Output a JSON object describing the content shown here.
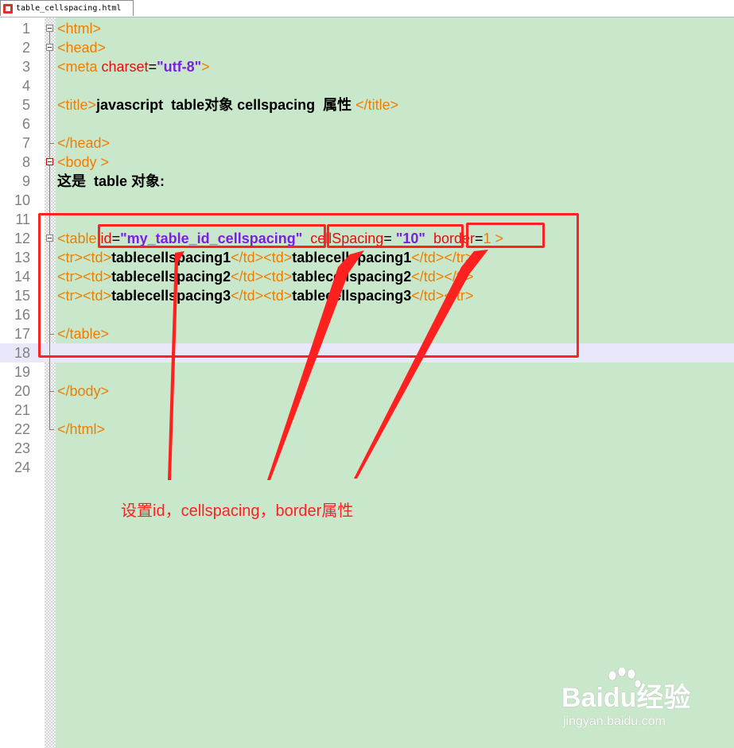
{
  "tab": {
    "label": "table_cellspacing.html"
  },
  "lines": [
    {
      "n": "1",
      "tokens": [
        [
          "t",
          "<html>"
        ]
      ]
    },
    {
      "n": "2",
      "tokens": [
        [
          "t",
          "<head>"
        ]
      ]
    },
    {
      "n": "3",
      "tokens": [
        [
          "t",
          "<meta "
        ],
        [
          "a",
          "charset"
        ],
        [
          "e",
          "="
        ],
        [
          "v",
          "\"utf-8\""
        ],
        [
          "t",
          ">"
        ]
      ]
    },
    {
      "n": "4",
      "tokens": []
    },
    {
      "n": "5",
      "tokens": [
        [
          "t",
          "<title>"
        ],
        [
          "x",
          "javascript  table对象 cellspacing  属性 "
        ],
        [
          "t",
          "</title>"
        ]
      ]
    },
    {
      "n": "6",
      "tokens": []
    },
    {
      "n": "7",
      "tokens": [
        [
          "t",
          "</head>"
        ]
      ]
    },
    {
      "n": "8",
      "tokens": [
        [
          "t",
          "<body >"
        ]
      ]
    },
    {
      "n": "9",
      "tokens": [
        [
          "x",
          "这是  table 对象:"
        ]
      ]
    },
    {
      "n": "10",
      "tokens": []
    },
    {
      "n": "11",
      "tokens": []
    },
    {
      "n": "12",
      "tokens": [
        [
          "t",
          "<table "
        ],
        [
          "a",
          "id"
        ],
        [
          "e",
          "="
        ],
        [
          "v",
          "\"my_table_id_cellspacing\""
        ],
        [
          "e",
          "  "
        ],
        [
          "a",
          "cellSpacing"
        ],
        [
          "e",
          "= "
        ],
        [
          "v",
          "\"10\""
        ],
        [
          "e",
          "  "
        ],
        [
          "a",
          "border"
        ],
        [
          "e",
          "="
        ],
        [
          "t",
          "1 >"
        ]
      ]
    },
    {
      "n": "13",
      "tokens": [
        [
          "t",
          "<tr><td>"
        ],
        [
          "x",
          "tablecellspacing1"
        ],
        [
          "t",
          "</td><td>"
        ],
        [
          "x",
          "tablecellspacing1"
        ],
        [
          "t",
          "</td></tr>"
        ]
      ]
    },
    {
      "n": "14",
      "tokens": [
        [
          "t",
          "<tr><td>"
        ],
        [
          "x",
          "tablecellspacing2"
        ],
        [
          "t",
          "</td><td>"
        ],
        [
          "x",
          "tablecellspacing2"
        ],
        [
          "t",
          "</td></tr>"
        ]
      ]
    },
    {
      "n": "15",
      "tokens": [
        [
          "t",
          "<tr><td>"
        ],
        [
          "x",
          "tablecellspacing3"
        ],
        [
          "t",
          "</td><td>"
        ],
        [
          "x",
          "tablecellspacing3"
        ],
        [
          "t",
          "</td></tr>"
        ]
      ]
    },
    {
      "n": "16",
      "tokens": []
    },
    {
      "n": "17",
      "tokens": [
        [
          "t",
          "</table>"
        ]
      ]
    },
    {
      "n": "18",
      "tokens": []
    },
    {
      "n": "19",
      "tokens": []
    },
    {
      "n": "20",
      "tokens": [
        [
          "t",
          "</body>"
        ]
      ]
    },
    {
      "n": "21",
      "tokens": []
    },
    {
      "n": "22",
      "tokens": [
        [
          "t",
          "</html>"
        ]
      ]
    },
    {
      "n": "23",
      "tokens": []
    },
    {
      "n": "24",
      "tokens": []
    }
  ],
  "annotation": {
    "text": "设置id，cellspacing，border属性"
  },
  "watermark": {
    "brand": "Baidu经验",
    "url": "jingyan.baidu.com"
  },
  "colors": {
    "tag": "#ef7d00",
    "attribute": "#e01010",
    "value": "#7b1fe6",
    "highlight": "#ff2222",
    "background": "#c9e8cb"
  }
}
